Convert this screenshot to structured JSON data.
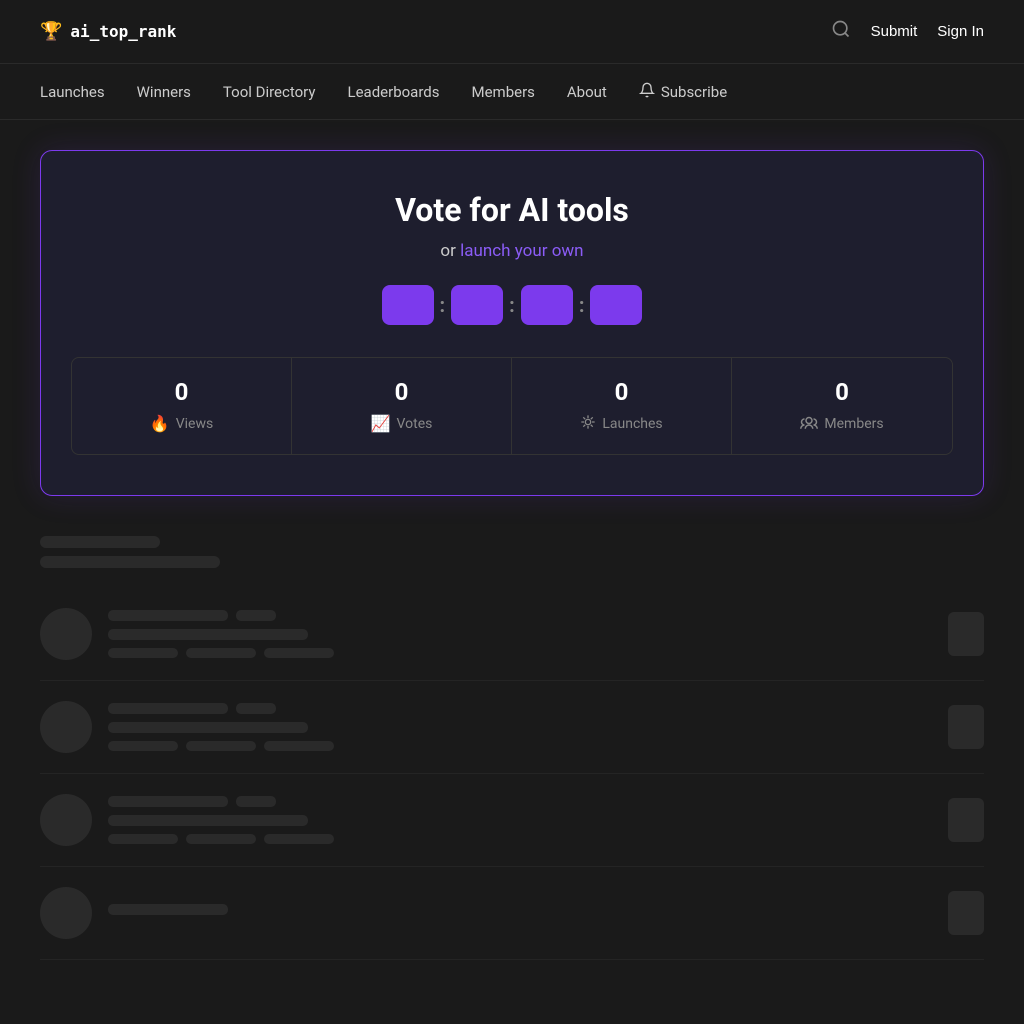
{
  "logo": {
    "icon": "🏆",
    "text": "ai_top_rank"
  },
  "header": {
    "submit_label": "Submit",
    "signin_label": "Sign In"
  },
  "nav": {
    "items": [
      {
        "label": "Launches",
        "id": "launches"
      },
      {
        "label": "Winners",
        "id": "winners"
      },
      {
        "label": "Tool Directory",
        "id": "tool-directory"
      },
      {
        "label": "Leaderboards",
        "id": "leaderboards"
      },
      {
        "label": "Members",
        "id": "members"
      },
      {
        "label": "About",
        "id": "about"
      }
    ],
    "subscribe_label": "Subscribe"
  },
  "hero": {
    "title": "Vote for AI tools",
    "subtitle_prefix": "or",
    "subtitle_link": "launch your own",
    "countdown": {
      "segments": [
        "",
        "",
        "",
        ""
      ]
    },
    "stats": [
      {
        "number": "0",
        "label": "Views",
        "icon": "🔥"
      },
      {
        "number": "0",
        "label": "Votes",
        "icon": "📈"
      },
      {
        "number": "0",
        "label": "Launches",
        "icon": "👥"
      },
      {
        "number": "0",
        "label": "Members",
        "icon": "👥"
      }
    ]
  },
  "skeleton": {
    "header_short": "",
    "header_medium": ""
  },
  "colors": {
    "accent": "#7c3aed",
    "accent_light": "#8b5cf6",
    "bg_dark": "#1a1a1a",
    "bg_card": "#1e1e2e",
    "skeleton": "#2a2a2a"
  }
}
